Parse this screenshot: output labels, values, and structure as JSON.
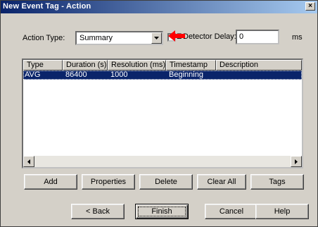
{
  "window": {
    "title": "New Event Tag - Action",
    "close_glyph": "×"
  },
  "action_type": {
    "label": "Action Type:",
    "value": "Summary"
  },
  "detector_delay": {
    "prefix": "E",
    "label": "Detector Delay:",
    "value": "0",
    "unit": "ms"
  },
  "arrow": {
    "color": "#ff0000"
  },
  "table": {
    "columns": [
      "Type",
      "Duration (s)",
      "Resolution (ms)",
      "Timestamp",
      "Description"
    ],
    "rows": [
      {
        "type": "AVG",
        "duration": "86400",
        "resolution": "1000",
        "timestamp": "Beginning",
        "description": ""
      }
    ],
    "selection_color": "#0a246a"
  },
  "buttons": {
    "add": "Add",
    "properties": "Properties",
    "delete": "Delete",
    "clear_all": "Clear All",
    "tags": "Tags",
    "back": "< Back",
    "finish": "Finish",
    "cancel": "Cancel",
    "help": "Help"
  },
  "colors": {
    "face": "#d4d0c8",
    "title_start": "#0a246a",
    "title_end": "#a6caf0"
  }
}
